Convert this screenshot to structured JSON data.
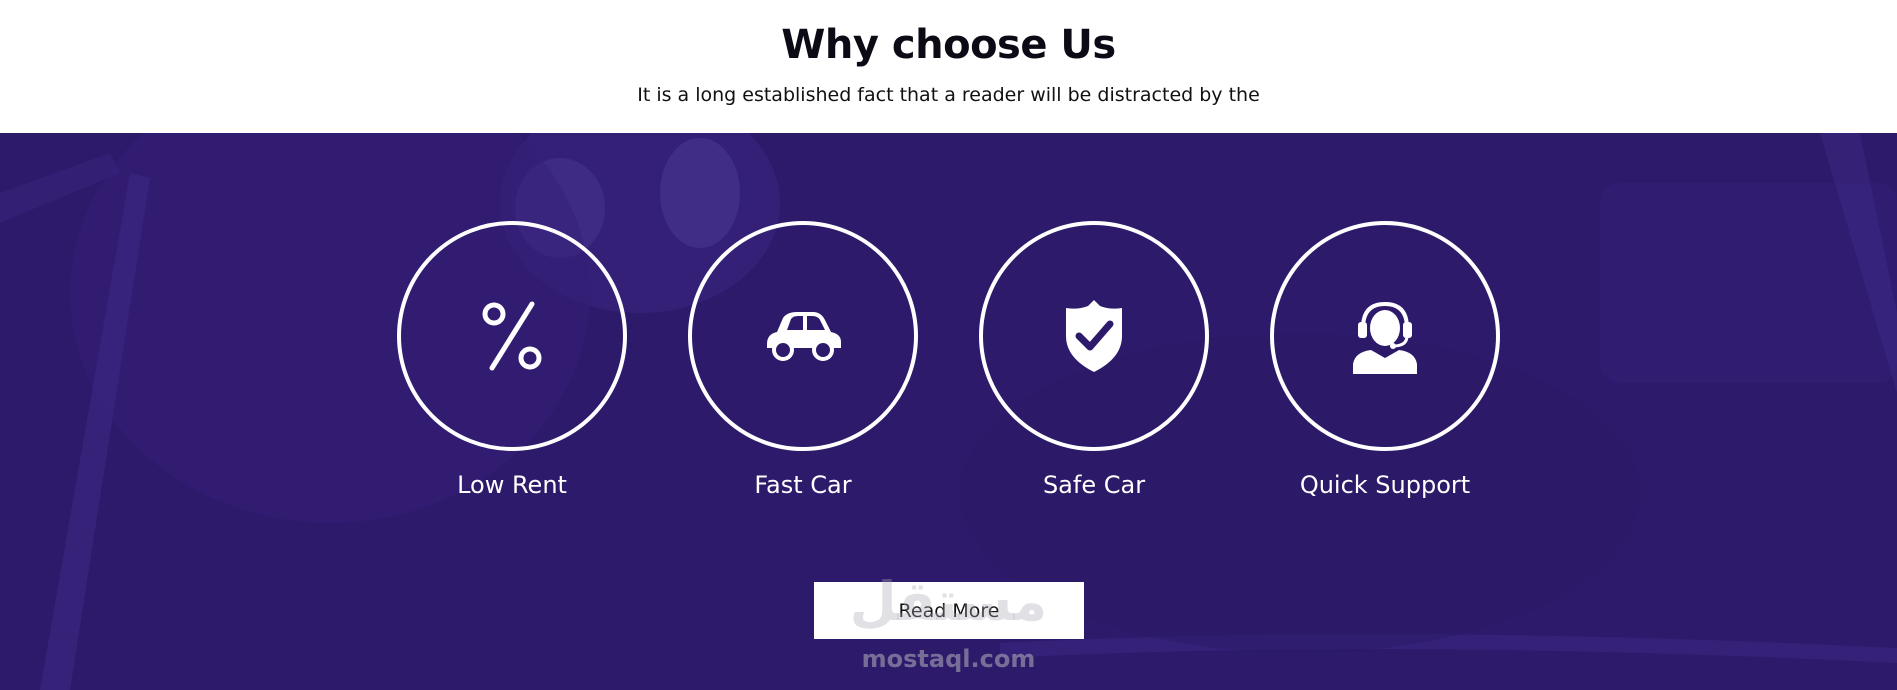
{
  "section": {
    "title": "Why choose Us",
    "subtitle": "It is a long established fact that a reader will be distracted by the"
  },
  "features": [
    {
      "label": "Low Rent",
      "icon": "percent-icon"
    },
    {
      "label": "Fast Car",
      "icon": "car-icon"
    },
    {
      "label": "Safe Car",
      "icon": "shield-check-icon"
    },
    {
      "label": "Quick Support",
      "icon": "support-agent-icon"
    }
  ],
  "cta": {
    "label": "Read More"
  },
  "watermark": {
    "logo": "مستقل",
    "text": "mostaql.com"
  },
  "colors": {
    "band": "#2e1a6b",
    "accent": "#ffffff",
    "title": "#0c0a14"
  }
}
